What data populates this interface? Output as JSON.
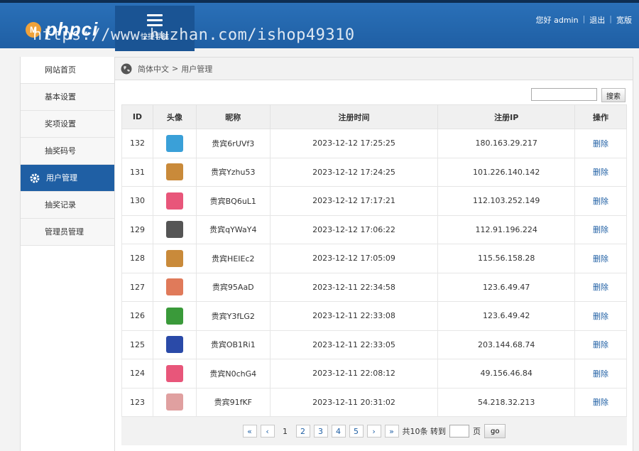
{
  "header": {
    "logo_mark": "M",
    "logo_text": "phpci",
    "nav_label": "快捷导航",
    "watermark": "https://www.huzhan.com/ishop49310",
    "greeting": "您好 admin",
    "logout": "退出",
    "wide": "宽版",
    "bar_color": "#1f5fa4"
  },
  "sidebar": {
    "items": [
      {
        "label": "网站首页"
      },
      {
        "label": "基本设置"
      },
      {
        "label": "奖项设置"
      },
      {
        "label": "抽奖码号"
      },
      {
        "label": "用户管理"
      },
      {
        "label": "抽奖记录"
      },
      {
        "label": "管理员管理"
      }
    ]
  },
  "breadcrumb": {
    "root": "简体中文",
    "sep": ">",
    "current": "用户管理"
  },
  "search": {
    "button": "搜索"
  },
  "table": {
    "headers": [
      "ID",
      "头像",
      "昵称",
      "注册时间",
      "注册IP",
      "操作"
    ],
    "rows": [
      {
        "id": "132",
        "avatar": "avatar-icon",
        "color": "#3aa0d8",
        "name": "贵宾6rUVf3",
        "time": "2023-12-12 17:25:25",
        "ip": "180.163.29.217",
        "action": "删除"
      },
      {
        "id": "131",
        "avatar": "avatar-icon",
        "color": "#c98a3a",
        "name": "贵宾Yzhu53",
        "time": "2023-12-12 17:24:25",
        "ip": "101.226.140.142",
        "action": "删除"
      },
      {
        "id": "130",
        "avatar": "avatar-icon",
        "color": "#e8567a",
        "name": "贵宾BQ6uL1",
        "time": "2023-12-12 17:17:21",
        "ip": "112.103.252.149",
        "action": "删除"
      },
      {
        "id": "129",
        "avatar": "avatar-icon",
        "color": "#555555",
        "name": "贵宾qYWaY4",
        "time": "2023-12-12 17:06:22",
        "ip": "112.91.196.224",
        "action": "删除"
      },
      {
        "id": "128",
        "avatar": "avatar-icon",
        "color": "#c98a3a",
        "name": "贵宾HEIEc2",
        "time": "2023-12-12 17:05:09",
        "ip": "115.56.158.28",
        "action": "删除"
      },
      {
        "id": "127",
        "avatar": "avatar-icon",
        "color": "#e07a5a",
        "name": "贵宾95AaD",
        "time": "2023-12-11 22:34:58",
        "ip": "123.6.49.47",
        "action": "删除"
      },
      {
        "id": "126",
        "avatar": "avatar-icon",
        "color": "#3a9a3a",
        "name": "贵宾Y3fLG2",
        "time": "2023-12-11 22:33:08",
        "ip": "123.6.49.42",
        "action": "删除"
      },
      {
        "id": "125",
        "avatar": "avatar-icon",
        "color": "#2a4aa8",
        "name": "贵宾OB1Ri1",
        "time": "2023-12-11 22:33:05",
        "ip": "203.144.68.74",
        "action": "删除"
      },
      {
        "id": "124",
        "avatar": "avatar-icon",
        "color": "#e8567a",
        "name": "贵宾N0chG4",
        "time": "2023-12-11 22:08:12",
        "ip": "49.156.46.84",
        "action": "删除"
      },
      {
        "id": "123",
        "avatar": "avatar-icon",
        "color": "#e0a0a0",
        "name": "贵宾91fKF",
        "time": "2023-12-11 20:31:02",
        "ip": "54.218.32.213",
        "action": "删除"
      }
    ]
  },
  "pager": {
    "first": "«",
    "prev": "‹",
    "pages": [
      "1",
      "2",
      "3",
      "4",
      "5"
    ],
    "next": "›",
    "last": "»",
    "total": "共10条 转到",
    "page_unit": "页",
    "go": "go"
  }
}
